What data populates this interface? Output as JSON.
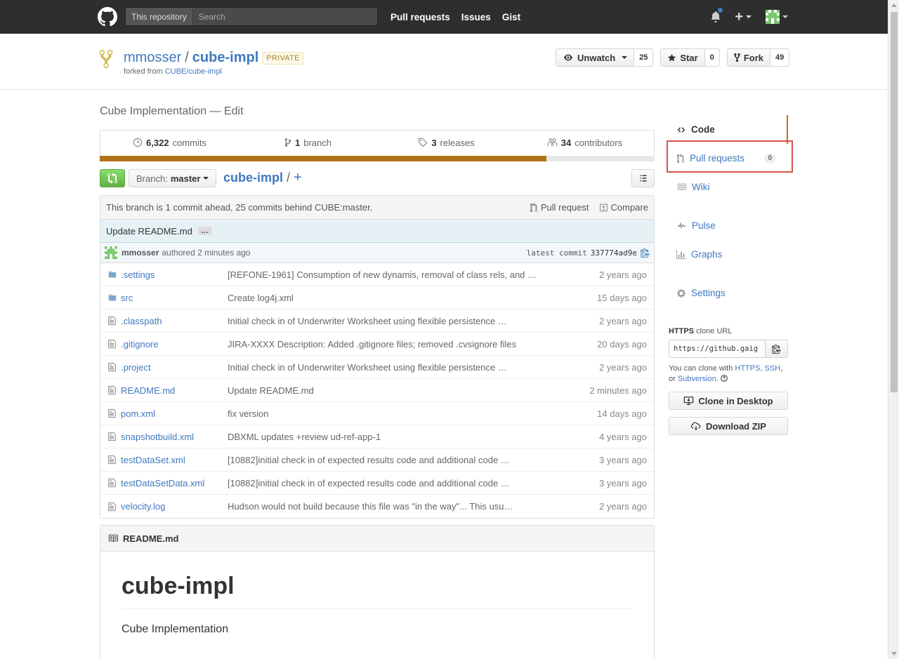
{
  "header": {
    "search_scope": "This repository",
    "search_placeholder": "Search",
    "nav": [
      "Pull requests",
      "Issues",
      "Gist"
    ],
    "plus_label": "+"
  },
  "repo": {
    "owner": "mmosser",
    "separator": "/",
    "name": "cube-impl",
    "visibility": "PRIVATE",
    "fork_prefix": "forked from",
    "fork_source": "CUBE/cube-impl",
    "unwatch_label": "Unwatch",
    "watch_count": "25",
    "star_label": "Star",
    "star_count": "0",
    "fork_label": "Fork",
    "fork_count": "49"
  },
  "description": "Cube Implementation — Edit",
  "summary": {
    "commits_num": "6,322",
    "commits_label": "commits",
    "branch_num": "1",
    "branch_label": "branch",
    "releases_num": "3",
    "releases_label": "releases",
    "contributors_num": "34",
    "contributors_label": "contributors",
    "language_fraction": 0.805,
    "language_color": "#b07219"
  },
  "file_nav": {
    "branch_prefix": "Branch:",
    "branch_name": "master",
    "root": "cube-impl",
    "slash": "/",
    "plus": "+"
  },
  "branch_info": {
    "text": "This branch is 1 commit ahead, 25 commits behind CUBE:master.",
    "pull_request": "Pull request",
    "compare": "Compare"
  },
  "commit": {
    "title": "Update README.md",
    "ellipsis": "…",
    "author": "mmosser",
    "authored": "authored 2 minutes ago",
    "latest_label": "latest commit",
    "sha": "337774ad9e"
  },
  "files": [
    {
      "type": "dir",
      "name": ".settings",
      "message": "[REFONE-1961] Consumption of new dynamis, removal of class rels, and …",
      "age": "2 years ago"
    },
    {
      "type": "dir",
      "name": "src",
      "message": "Create log4j.xml",
      "age": "15 days ago"
    },
    {
      "type": "file",
      "name": ".classpath",
      "message": "Initial check in of Underwriter Worksheet using flexible persistence …",
      "age": "2 years ago"
    },
    {
      "type": "file",
      "name": ".gitignore",
      "message": "JIRA-XXXX Description: Added .gitignore files; removed .cvsignore files",
      "age": "20 days ago"
    },
    {
      "type": "file",
      "name": ".project",
      "message": "Initial check in of Underwriter Worksheet using flexible persistence …",
      "age": "2 years ago"
    },
    {
      "type": "file",
      "name": "README.md",
      "message": "Update README.md",
      "age": "2 minutes ago"
    },
    {
      "type": "file",
      "name": "pom.xml",
      "message": "fix version",
      "age": "14 days ago"
    },
    {
      "type": "file",
      "name": "snapshotbuild.xml",
      "message": "DBXML updates +review ud-ref-app-1",
      "age": "4 years ago"
    },
    {
      "type": "file",
      "name": "testDataSet.xml",
      "message": "[10882]initial check in of expected results code and additional code …",
      "age": "3 years ago"
    },
    {
      "type": "file",
      "name": "testDataSetData.xml",
      "message": "[10882]initial check in of expected results code and additional code …",
      "age": "3 years ago"
    },
    {
      "type": "file",
      "name": "velocity.log",
      "message": "Hudson would not build because this file was \"in the way\"... This usu…",
      "age": "2 years ago"
    }
  ],
  "readme": {
    "file": "README.md",
    "heading": "cube-impl",
    "body": "Cube Implementation"
  },
  "sidebar": {
    "code": "Code",
    "pull_requests": "Pull requests",
    "pull_requests_count": "0",
    "wiki": "Wiki",
    "pulse": "Pulse",
    "graphs": "Graphs",
    "settings": "Settings"
  },
  "clone": {
    "protocol": "HTTPS",
    "label_suffix": "clone URL",
    "url": "https://github.gaig",
    "help_prefix": "You can clone with",
    "https": "HTTPS",
    "ssh": "SSH",
    "or": "or",
    "subversion": "Subversion",
    "desktop": "Clone in Desktop",
    "zip": "Download ZIP"
  },
  "colors": {
    "header_bg": "#2e2e2e",
    "link": "#4078c0",
    "highlight": "#d9534f",
    "selected_nav_border": "#d26911"
  }
}
